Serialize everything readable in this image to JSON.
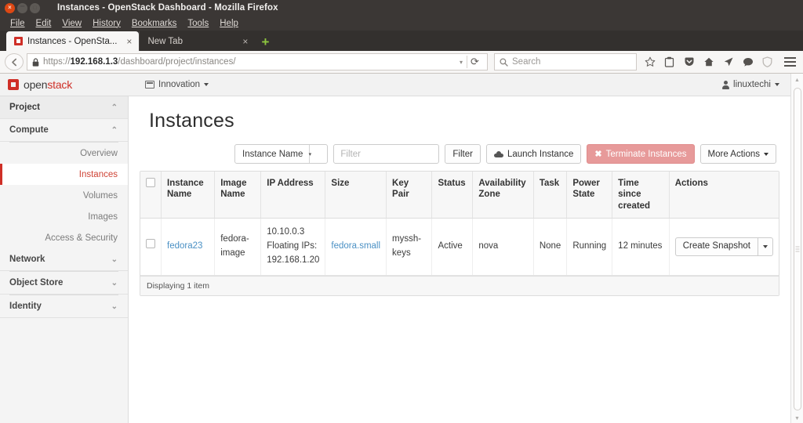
{
  "window": {
    "title": "Instances - OpenStack Dashboard - Mozilla Firefox",
    "close_glyph": "×",
    "minimize_glyph": "–",
    "maximize_glyph": "□"
  },
  "menubar": {
    "items": [
      {
        "label": "File",
        "mnemonic": "F"
      },
      {
        "label": "Edit",
        "mnemonic": "E"
      },
      {
        "label": "View",
        "mnemonic": "V"
      },
      {
        "label": "History",
        "mnemonic": "s"
      },
      {
        "label": "Bookmarks",
        "mnemonic": "B"
      },
      {
        "label": "Tools",
        "mnemonic": "T"
      },
      {
        "label": "Help",
        "mnemonic": "H"
      }
    ]
  },
  "tabs": [
    {
      "label": "Instances - OpenSta...",
      "active": true,
      "close_glyph": "×"
    },
    {
      "label": "New Tab",
      "active": false,
      "close_glyph": "×"
    }
  ],
  "new_tab_glyph": "+",
  "navbar": {
    "back_glyph": "←",
    "lock_glyph": "ὑ2",
    "url_scheme": "https://",
    "url_host": "192.168.1.3",
    "url_path": "/dashboard/project/instances/",
    "url_caret": "▾",
    "reload_glyph": "⟳",
    "search_placeholder": "Search",
    "search_glyph": "⌕",
    "icons": [
      "star-icon",
      "reader-icon",
      "pocket-icon",
      "home-icon",
      "share-icon",
      "chat-icon",
      "shield-icon"
    ]
  },
  "openstack": {
    "brand_open": "open",
    "brand_stack": "stack",
    "brand_color": "#cf2f27",
    "project_label": "Innovation",
    "user_label": "linuxtechi"
  },
  "sidebar": {
    "groups": [
      {
        "label": "Project",
        "level": 0,
        "chevron": "⌃",
        "items": []
      },
      {
        "label": "Compute",
        "level": 1,
        "chevron": "⌃",
        "items": [
          {
            "label": "Overview",
            "active": false
          },
          {
            "label": "Instances",
            "active": true
          },
          {
            "label": "Volumes",
            "active": false
          },
          {
            "label": "Images",
            "active": false
          },
          {
            "label": "Access & Security",
            "active": false
          }
        ]
      },
      {
        "label": "Network",
        "level": 1,
        "chevron": "⌄",
        "items": []
      },
      {
        "label": "Object Store",
        "level": 1,
        "chevron": "⌄",
        "items": []
      },
      {
        "label": "Identity",
        "level": 1,
        "chevron": "⌄",
        "items": []
      }
    ]
  },
  "page": {
    "title": "Instances"
  },
  "toolbar": {
    "filter_field": "Instance Name",
    "filter_placeholder": "Filter",
    "filter_value": "",
    "filter_button": "Filter",
    "launch_button": "Launch Instance",
    "terminate_button": "Terminate Instances",
    "terminate_glyph": "✖",
    "more_actions": "More Actions",
    "caret_glyph": "▾"
  },
  "table": {
    "columns": [
      "Instance Name",
      "Image Name",
      "IP Address",
      "Size",
      "Key Pair",
      "Status",
      "Availability Zone",
      "Task",
      "Power State",
      "Time since created",
      "Actions"
    ],
    "rows": [
      {
        "instance_name": "fedora23",
        "image_name": "fedora-image",
        "ip_primary": "10.10.0.3",
        "ip_floating_label": "Floating IPs:",
        "ip_floating": "192.168.1.20",
        "size": "fedora.small",
        "key_pair": "myssh-keys",
        "status": "Active",
        "availability_zone": "nova",
        "task": "None",
        "power_state": "Running",
        "time_since_created": "12 minutes",
        "action_label": "Create Snapshot",
        "action_caret": "▾"
      }
    ],
    "footer": "Displaying 1 item"
  },
  "scrollbar": {
    "up_glyph": "▲",
    "down_glyph": "▼"
  }
}
